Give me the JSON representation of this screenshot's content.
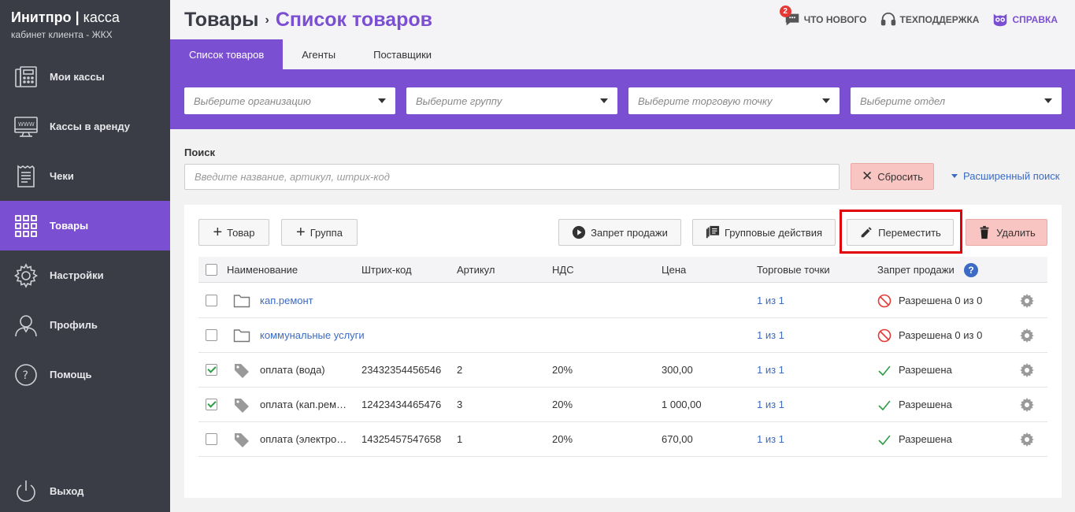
{
  "brand": {
    "title_bold": "Инитпро",
    "title_sep": " | ",
    "title_thin": "касса",
    "subtitle": "кабинет клиента - ЖКХ"
  },
  "sidebar": {
    "items": [
      {
        "label": "Мои кассы",
        "icon": "cash-register-icon"
      },
      {
        "label": "Кассы в аренду",
        "icon": "www-monitor-icon"
      },
      {
        "label": "Чеки",
        "icon": "receipt-icon"
      },
      {
        "label": "Товары",
        "icon": "grid-icon",
        "active": true
      },
      {
        "label": "Настройки",
        "icon": "gear-icon"
      },
      {
        "label": "Профиль",
        "icon": "user-icon"
      },
      {
        "label": "Помощь",
        "icon": "question-icon"
      }
    ],
    "logout": "Выход"
  },
  "header": {
    "crumb_parent": "Товары",
    "crumb_sep": "›",
    "crumb_current": "Список товаров",
    "whats_new": "ЧТО НОВОГО",
    "whats_new_badge": "2",
    "support": "ТЕХПОДДЕРЖКА",
    "help": "СПРАВКА"
  },
  "tabs": [
    "Список товаров",
    "Агенты",
    "Поставщики"
  ],
  "filters": {
    "organization": "Выберите организацию",
    "group": "Выберите группу",
    "point": "Выберите торговую точку",
    "department": "Выберите отдел"
  },
  "search": {
    "label": "Поиск",
    "placeholder": "Введите название, артикул, штрих-код",
    "reset": "Сбросить",
    "advanced": "Расширенный поиск"
  },
  "toolbar": {
    "add_item": "Товар",
    "add_group": "Группа",
    "ban_sale": "Запрет продажи",
    "group_actions": "Групповые действия",
    "move": "Переместить",
    "delete": "Удалить"
  },
  "table": {
    "headers": [
      "Наименование",
      "Штрих-код",
      "Артикул",
      "НДС",
      "Цена",
      "Торговые точки",
      "Запрет продажи"
    ],
    "rows": [
      {
        "type": "folder",
        "checked": false,
        "name": "кап.ремонт",
        "barcode": "",
        "article": "",
        "vat": "",
        "price": "",
        "points": "1 из 1",
        "status": "Разрешена 0 из 0",
        "status_kind": "banned"
      },
      {
        "type": "folder",
        "checked": false,
        "name": "коммунальные услуги",
        "barcode": "",
        "article": "",
        "vat": "",
        "price": "",
        "points": "1 из 1",
        "status": "Разрешена 0 из 0",
        "status_kind": "banned"
      },
      {
        "type": "item",
        "checked": true,
        "name": "оплата (вода)",
        "barcode": "23432354456546",
        "article": "2",
        "vat": "20%",
        "price": "300,00",
        "points": "1 из 1",
        "status": "Разрешена",
        "status_kind": "ok"
      },
      {
        "type": "item",
        "checked": true,
        "name": "оплата (кап.рем…",
        "barcode": "12423434465476",
        "article": "3",
        "vat": "20%",
        "price": "1 000,00",
        "points": "1 из 1",
        "status": "Разрешена",
        "status_kind": "ok"
      },
      {
        "type": "item",
        "checked": false,
        "name": "оплата (электро…",
        "barcode": "14325457547658",
        "article": "1",
        "vat": "20%",
        "price": "670,00",
        "points": "1 из 1",
        "status": "Разрешена",
        "status_kind": "ok"
      }
    ]
  },
  "colors": {
    "accent": "#7b4fd1",
    "sidebar": "#3a3d46",
    "link": "#3b6bc4",
    "danger_bg": "#f9c5c2",
    "highlight": "#e0000a"
  }
}
